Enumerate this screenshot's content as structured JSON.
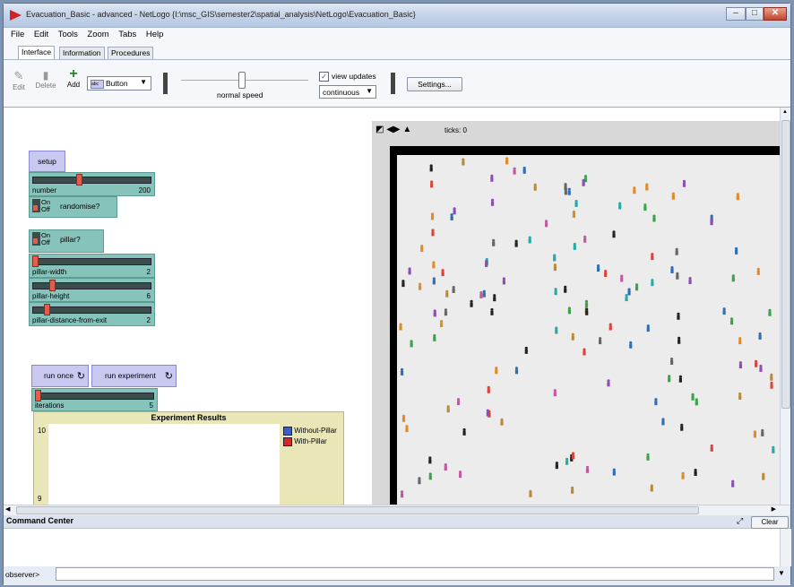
{
  "window": {
    "title": "Evacuation_Basic - advanced - NetLogo {I:\\msc_GIS\\semester2\\spatial_analysis\\NetLogo\\Evacuation_Basic}",
    "controls": [
      "–",
      "□",
      "✕"
    ]
  },
  "menu": [
    "File",
    "Edit",
    "Tools",
    "Zoom",
    "Tabs",
    "Help"
  ],
  "tabs": [
    "Interface",
    "Information",
    "Procedures"
  ],
  "toolbar": {
    "edit": "Edit",
    "delete": "Delete",
    "add": "Add",
    "widget_select": "Button",
    "speed_label": "normal speed",
    "view_updates": "view updates",
    "update_mode": "continuous",
    "settings": "Settings..."
  },
  "widgets": {
    "setup": "setup",
    "number": {
      "label": "number",
      "value": "200",
      "fraction": 0.2
    },
    "randomise": {
      "on": "On",
      "off": "Off",
      "label": "randomise?"
    },
    "pillar": {
      "on": "On",
      "off": "Off",
      "label": "pillar?"
    },
    "pillar_width": {
      "label": "pillar-width",
      "value": "2",
      "fraction": 0.0
    },
    "pillar_height": {
      "label": "pillar-height",
      "value": "6",
      "fraction": 0.15
    },
    "pillar_distance": {
      "label": "pillar-distance-from-exit",
      "value": "2",
      "fraction": 0.1
    },
    "run_once": "run once",
    "run_experiment": "run experiment",
    "iterations": {
      "label": "iterations",
      "value": "5",
      "fraction": 0.0
    }
  },
  "plot": {
    "title": "Experiment Results",
    "y_top": "10",
    "y_bottom": "9",
    "legend": [
      {
        "name": "Without-Pillar",
        "color": "#3a5fcd"
      },
      {
        "name": "With-Pillar",
        "color": "#d62828"
      }
    ]
  },
  "view": {
    "ticks": "ticks: 0"
  },
  "command_center": {
    "title": "Command Center",
    "clear": "Clear",
    "prompt": "observer>"
  }
}
